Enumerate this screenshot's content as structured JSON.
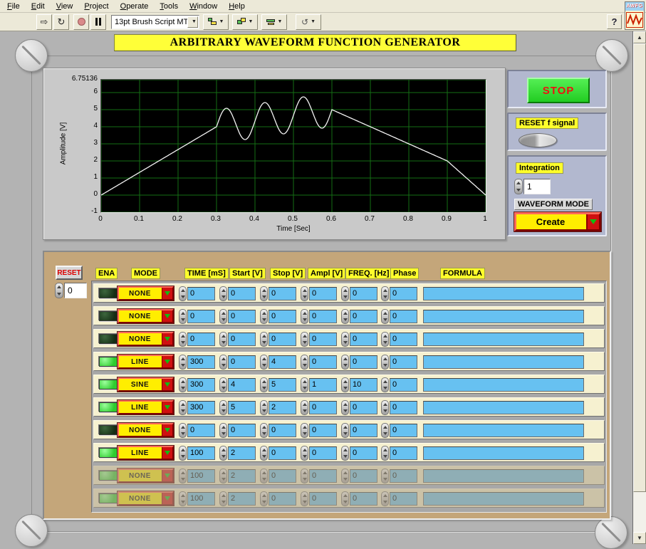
{
  "window": {
    "menu": [
      "File",
      "Edit",
      "View",
      "Project",
      "Operate",
      "Tools",
      "Window",
      "Help"
    ],
    "vi_icon_text": "AWFG"
  },
  "toolbar": {
    "font_selector": "13pt Brush Script MT",
    "help_label": "?"
  },
  "title_banner": "ARBITRARY WAVEFORM FUNCTION GENERATOR",
  "chart_data": {
    "type": "line",
    "title": "",
    "xlabel": "Time [Sec]",
    "ylabel": "Amplitude [V]",
    "xlim": [
      0,
      1
    ],
    "ylim": [
      -1,
      6.75136
    ],
    "x_ticks": [
      "0",
      "0.1",
      "0.2",
      "0.3",
      "0.4",
      "0.5",
      "0.6",
      "0.7",
      "0.8",
      "0.9",
      "1"
    ],
    "y_ticks": [
      "6.75136",
      "6",
      "5",
      "4",
      "3",
      "2",
      "1",
      "0",
      "-1"
    ],
    "grid": true,
    "grid_color": "#156e15",
    "plot_bg": "#000000",
    "line_color": "#f2f2f2",
    "segments": [
      {
        "mode": "LINE",
        "t0": 0.0,
        "t1": 0.3,
        "v0": 0,
        "v1": 4,
        "amp": 0,
        "freq": 0
      },
      {
        "mode": "SINE",
        "t0": 0.3,
        "t1": 0.6,
        "v0": 4,
        "v1": 5,
        "amp": 1,
        "freq": 10
      },
      {
        "mode": "LINE",
        "t0": 0.6,
        "t1": 0.9,
        "v0": 5,
        "v1": 2,
        "amp": 0,
        "freq": 0
      },
      {
        "mode": "LINE",
        "t0": 0.9,
        "t1": 1.0,
        "v0": 2,
        "v1": 0,
        "amp": 0,
        "freq": 0
      }
    ]
  },
  "controls": {
    "stop_label": "STOP",
    "reset_f_signal_label": "RESET f signal",
    "integration_label": "Integration",
    "integration_value": "1",
    "waveform_mode_label": "WAVEFORM MODE",
    "waveform_mode_value": "Create"
  },
  "table": {
    "reset_label": "RESET",
    "reset_value": "0",
    "columns": [
      "ENA",
      "MODE",
      "TIME [mS]",
      "Start [V]",
      "Stop [V]",
      "Ampl [V]",
      "FREQ. [Hz]",
      "Phase",
      "FORMULA"
    ],
    "rows": [
      {
        "ena": false,
        "mode": "NONE",
        "time": "0",
        "start": "0",
        "stop": "0",
        "ampl": "0",
        "freq": "0",
        "phase": "0",
        "formula": "",
        "disabled": false
      },
      {
        "ena": false,
        "mode": "NONE",
        "time": "0",
        "start": "0",
        "stop": "0",
        "ampl": "0",
        "freq": "0",
        "phase": "0",
        "formula": "",
        "disabled": false
      },
      {
        "ena": false,
        "mode": "NONE",
        "time": "0",
        "start": "0",
        "stop": "0",
        "ampl": "0",
        "freq": "0",
        "phase": "0",
        "formula": "",
        "disabled": false
      },
      {
        "ena": true,
        "mode": "LINE",
        "time": "300",
        "start": "0",
        "stop": "4",
        "ampl": "0",
        "freq": "0",
        "phase": "0",
        "formula": "",
        "disabled": false
      },
      {
        "ena": true,
        "mode": "SINE",
        "time": "300",
        "start": "4",
        "stop": "5",
        "ampl": "1",
        "freq": "10",
        "phase": "0",
        "formula": "",
        "disabled": false
      },
      {
        "ena": true,
        "mode": "LINE",
        "time": "300",
        "start": "5",
        "stop": "2",
        "ampl": "0",
        "freq": "0",
        "phase": "0",
        "formula": "",
        "disabled": false
      },
      {
        "ena": false,
        "mode": "NONE",
        "time": "0",
        "start": "0",
        "stop": "0",
        "ampl": "0",
        "freq": "0",
        "phase": "0",
        "formula": "",
        "disabled": false
      },
      {
        "ena": true,
        "mode": "LINE",
        "time": "100",
        "start": "2",
        "stop": "0",
        "ampl": "0",
        "freq": "0",
        "phase": "0",
        "formula": "",
        "disabled": false
      },
      {
        "ena": true,
        "mode": "NONE",
        "time": "100",
        "start": "2",
        "stop": "0",
        "ampl": "0",
        "freq": "0",
        "phase": "0",
        "formula": "",
        "disabled": true
      },
      {
        "ena": true,
        "mode": "NONE",
        "time": "100",
        "start": "2",
        "stop": "0",
        "ampl": "0",
        "freq": "0",
        "phase": "0",
        "formula": "",
        "disabled": true
      }
    ]
  }
}
